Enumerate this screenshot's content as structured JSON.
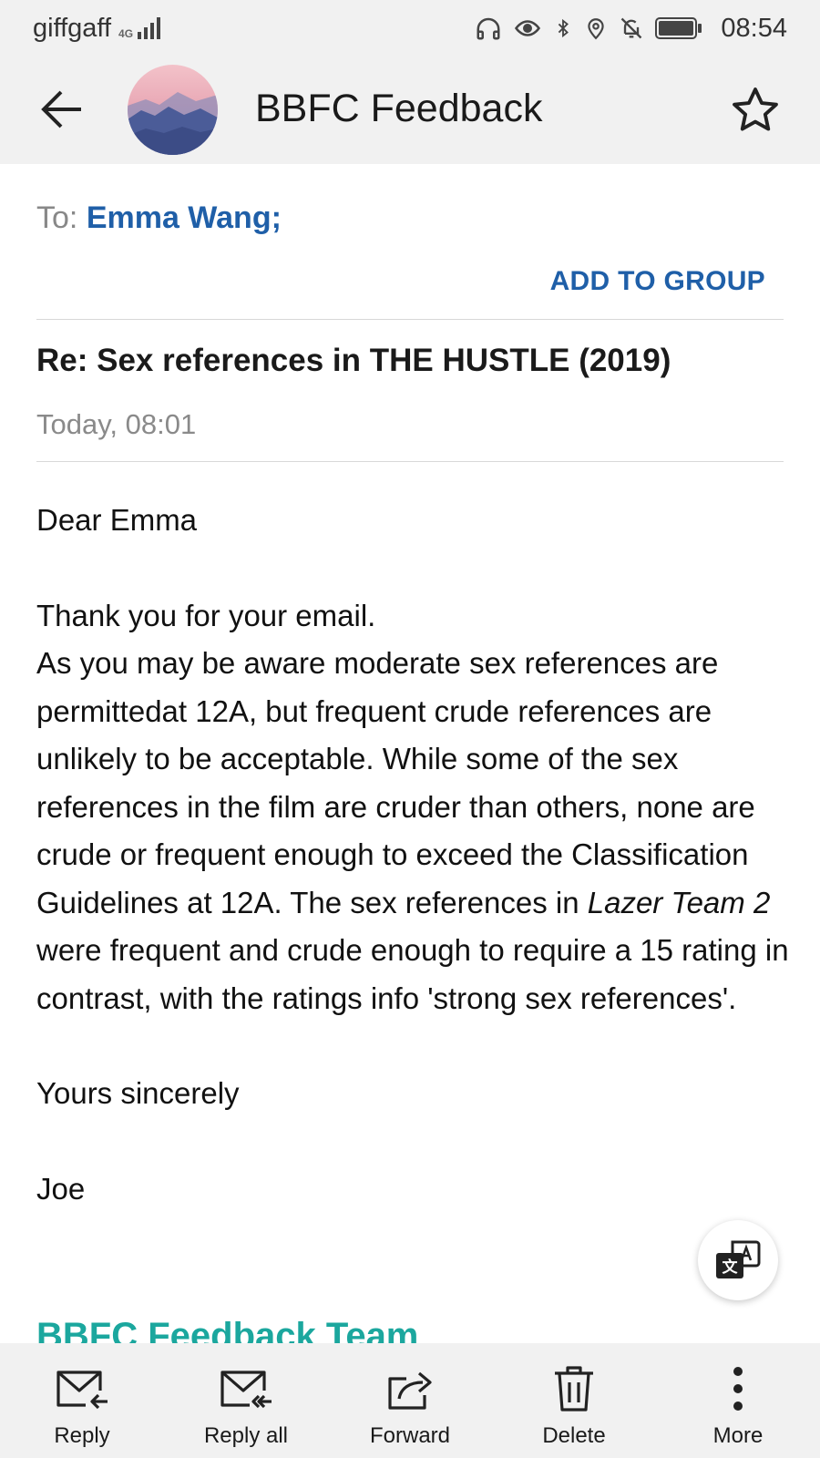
{
  "status_bar": {
    "carrier": "giffgaff",
    "network": "4G",
    "time": "08:54"
  },
  "header": {
    "title": "BBFC Feedback"
  },
  "recipients": {
    "to_label": "To:",
    "to_name": "Emma Wang;",
    "add_to_group": "ADD TO GROUP"
  },
  "message": {
    "subject": "Re: Sex references in THE HUSTLE (2019)",
    "date": "Today, 08:01",
    "greeting": "Dear Emma",
    "p1": "Thank you for your email.",
    "p2_before": "As you may be aware moderate sex references are permittedat 12A, but frequent crude references are unlikely to be acceptable.  While some of the sex references in the film are cruder than others, none are crude or frequent enough to exceed the Classification Guidelines at 12A.  The sex references in ",
    "p2_italic": "Lazer Team 2",
    "p2_after": " were frequent and crude enough to require a 15 rating in contrast, with the ratings info 'strong sex references'.",
    "closing": "Yours sincerely",
    "signature": "Joe",
    "team": "BBFC Feedback Team"
  },
  "toolbar": {
    "reply": "Reply",
    "reply_all": "Reply all",
    "forward": "Forward",
    "delete": "Delete",
    "more": "More"
  },
  "colors": {
    "link": "#1f5fa8",
    "team": "#1ba79e",
    "bar_bg": "#f1f1f1"
  }
}
